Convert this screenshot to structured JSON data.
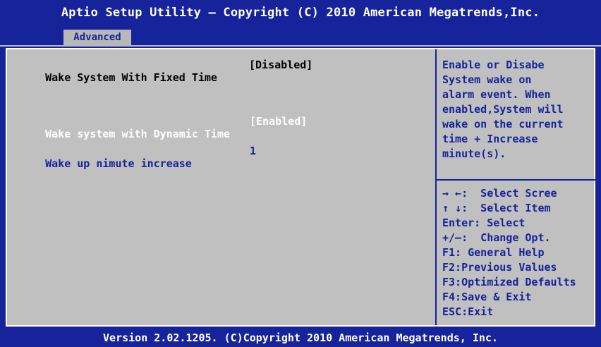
{
  "header": {
    "title": "Aptio Setup Utility – Copyright (C) 2010 American Megatrends,Inc."
  },
  "tabs": [
    {
      "label": "Advanced",
      "active": true
    }
  ],
  "settings": [
    {
      "label": "Wake System With Fixed Time",
      "value": "[Disabled]",
      "state": "selected"
    },
    {
      "label": "Wake system with Dynamic Time",
      "value": "[Enabled]",
      "state": "disabled"
    },
    {
      "label": "Wake up nimute increase",
      "value": "1",
      "state": "normal"
    }
  ],
  "help": {
    "lines": [
      "Enable or Disabe",
      "System wake on",
      "alarm event. When",
      "enabled,System will",
      "wake on the current",
      "time + Increase",
      "minute(s)."
    ]
  },
  "keys": [
    "→ ←:  Select Scree",
    "↑ ↓:  Select Item",
    "Enter: Select",
    "+/–:  Change Opt.",
    "F1: General Help",
    "F2:Previous Values",
    "F3:Optimized Defaults",
    "F4:Save & Exit",
    "ESC:Exit"
  ],
  "footer": {
    "text": "Version 2.02.1205. (C)Copyright 2010 American Megatrends, Inc."
  },
  "colors": {
    "background": "#16239a",
    "panel": "#c0c0c0",
    "selected_text": "#000000",
    "normal_text": "#16239a",
    "disabled_text": "#ffffff"
  }
}
